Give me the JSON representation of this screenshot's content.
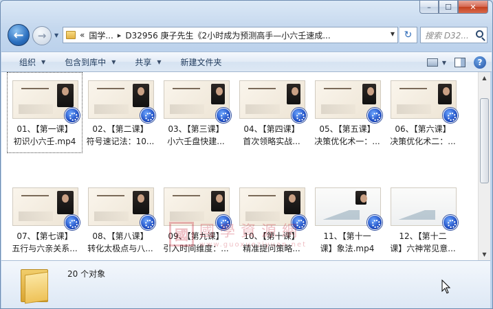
{
  "window": {
    "caption": {
      "minimize_label": "–",
      "maximize_label": "☐",
      "close_label": "✕"
    }
  },
  "address": {
    "overflow_label": "«",
    "crumbs": [
      "国学...",
      "D32956 庚子先生《2小时成为预测高手—小六壬速成..."
    ],
    "search_placeholder": "搜索 D32..."
  },
  "toolbar": {
    "organize": "组织",
    "include_in_library": "包含到库中",
    "share": "共享",
    "new_folder": "新建文件夹"
  },
  "files": [
    {
      "line1": "01、【第一课】",
      "line2": "初识小六壬.mp4",
      "style": "ink"
    },
    {
      "line1": "02、【第二课】",
      "line2": "符号速记法：10...",
      "style": "ink"
    },
    {
      "line1": "03、【第三课】",
      "line2": "小六壬盘快建...",
      "style": "diagram"
    },
    {
      "line1": "04、【第四课】",
      "line2": "首次领略实战...",
      "style": "diagram"
    },
    {
      "line1": "05、【第五课】",
      "line2": "决策优化术一：...",
      "style": "diagram"
    },
    {
      "line1": "06、【第六课】",
      "line2": "决策优化术二：...",
      "style": "diagram"
    },
    {
      "line1": "07、【第七课】",
      "line2": "五行与六亲关系...",
      "style": "ink"
    },
    {
      "line1": "08、【第八课】",
      "line2": "转化太极点与八...",
      "style": "ink"
    },
    {
      "line1": "09、【第九课】",
      "line2": "引入时间维度：...",
      "style": "diagram"
    },
    {
      "line1": "10、【第十课】",
      "line2": "精准提问策略...",
      "style": "ink"
    },
    {
      "line1": "11、【第十一",
      "line2": "课】象法.mp4",
      "style": "plain"
    },
    {
      "line1": "12、【第十二",
      "line2": "课】六神常见意...",
      "style": "plain"
    }
  ],
  "watermark": {
    "seal": "國",
    "cn": "國學資源網",
    "url": "www.guoxueziyuan.net"
  },
  "status": {
    "count": "20 个对象"
  },
  "colors": {
    "accent": "#2b6fbf",
    "window_frame": "#c5d8ee",
    "close": "#c3401f"
  }
}
